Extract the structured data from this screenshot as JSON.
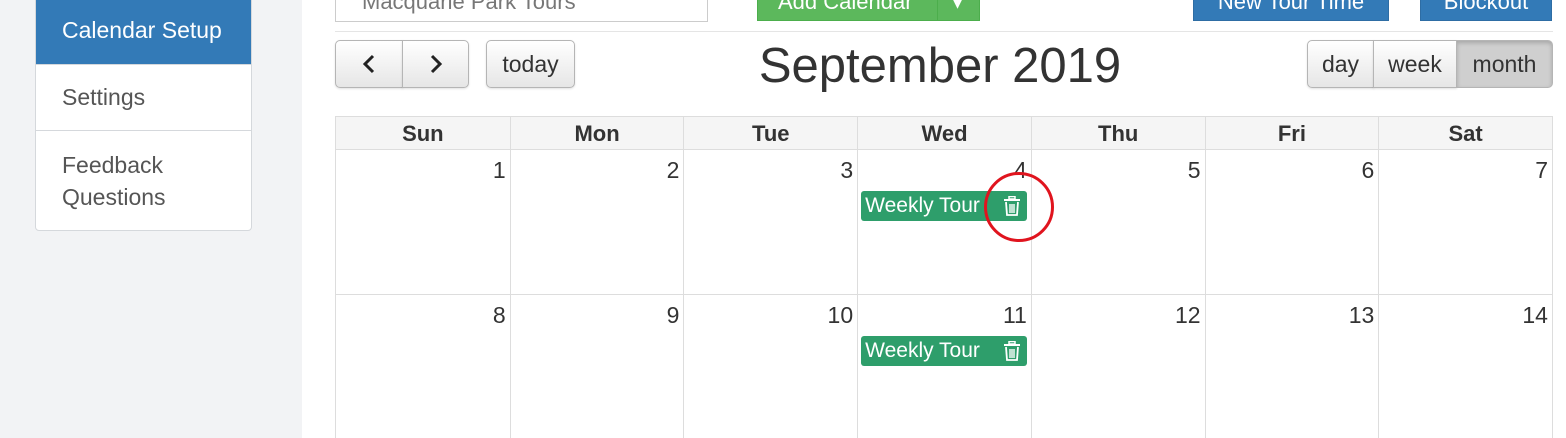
{
  "sidebar": {
    "items": [
      {
        "label": "Calendar Setup",
        "active": true
      },
      {
        "label": "Settings"
      },
      {
        "label": "Feedback Questions"
      }
    ]
  },
  "toolbar_top": {
    "calendar_select_value": "Macquarie Park Tours",
    "add_calendar_label": "Add Calendar",
    "new_tour_time_label": "New Tour Time",
    "blockout_label": "Blockout"
  },
  "calendar": {
    "title": "September 2019",
    "today_label": "today",
    "view_buttons": {
      "day": "day",
      "week": "week",
      "month": "month"
    },
    "active_view": "month",
    "weekdays": [
      "Sun",
      "Mon",
      "Tue",
      "Wed",
      "Thu",
      "Fri",
      "Sat"
    ],
    "weeks": [
      [
        "1",
        "2",
        "3",
        "4",
        "5",
        "6",
        "7"
      ],
      [
        "8",
        "9",
        "10",
        "11",
        "12",
        "13",
        "14"
      ]
    ],
    "events": [
      {
        "title": "Weekly Tour",
        "day": "4",
        "color": "#2e9e6b"
      },
      {
        "title": "Weekly Tour",
        "day": "11",
        "color": "#2e9e6b"
      }
    ]
  },
  "colors": {
    "primary": "#337ab7",
    "success": "#5cb85c",
    "event": "#2e9e6b",
    "annotation": "#e0141e"
  },
  "icons": [
    "chevron-left-icon",
    "chevron-right-icon",
    "trash-icon",
    "caret-down-icon"
  ]
}
